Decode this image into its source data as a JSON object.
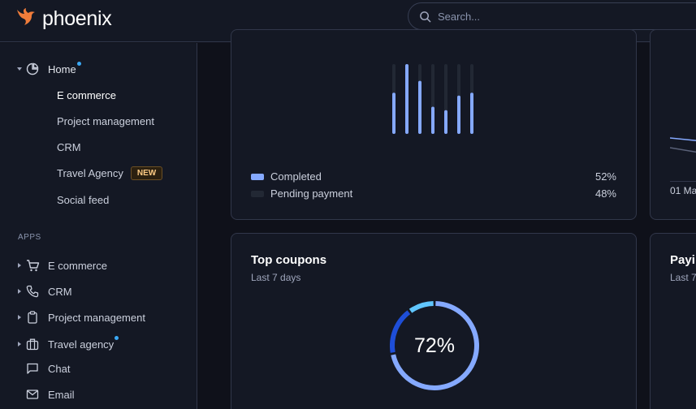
{
  "brand": {
    "name": "phoenix",
    "accent": "#f07c3a"
  },
  "search": {
    "placeholder": "Search..."
  },
  "sidebar": {
    "home": {
      "label": "Home",
      "icon": "pie-chart-icon"
    },
    "home_items": [
      {
        "label": "E commerce",
        "active": true
      },
      {
        "label": "Project management"
      },
      {
        "label": "CRM"
      },
      {
        "label": "Travel Agency",
        "badge": "NEW"
      },
      {
        "label": "Social feed"
      }
    ],
    "apps_label": "APPS",
    "apps": [
      {
        "label": "E commerce",
        "icon": "cart-icon"
      },
      {
        "label": "CRM",
        "icon": "phone-icon"
      },
      {
        "label": "Project management",
        "icon": "clipboard-icon"
      },
      {
        "label": "Travel agency",
        "icon": "briefcase-icon"
      },
      {
        "label": "Chat",
        "icon": "message-square-icon"
      },
      {
        "label": "Email",
        "icon": "mail-icon"
      }
    ]
  },
  "orders_card": {
    "bars": [
      {
        "completed": 0.59,
        "total": 1.0
      },
      {
        "completed": 1.0,
        "total": 1.0
      },
      {
        "completed": 0.76,
        "total": 1.0
      },
      {
        "completed": 0.39,
        "total": 1.0
      },
      {
        "completed": 0.34,
        "total": 1.0
      },
      {
        "completed": 0.55,
        "total": 1.0
      },
      {
        "completed": 0.59,
        "total": 1.0
      }
    ],
    "legend": [
      {
        "label": "Completed",
        "value": "52%",
        "color": "#85a9ff"
      },
      {
        "label": "Pending payment",
        "value": "48%",
        "color": "#222834"
      }
    ]
  },
  "right_card_top": {
    "date_label": "01 Ma"
  },
  "coupons_card": {
    "title": "Top coupons",
    "subtitle": "Last 7 days",
    "percent_label": "72%",
    "segments": [
      {
        "value": 72,
        "color": "#85a9ff"
      },
      {
        "value": 18,
        "color": "#1e4ed8"
      },
      {
        "value": 10,
        "color": "#60c6ff"
      }
    ]
  },
  "paying_card": {
    "title": "Payi",
    "subtitle": "Last 7"
  }
}
